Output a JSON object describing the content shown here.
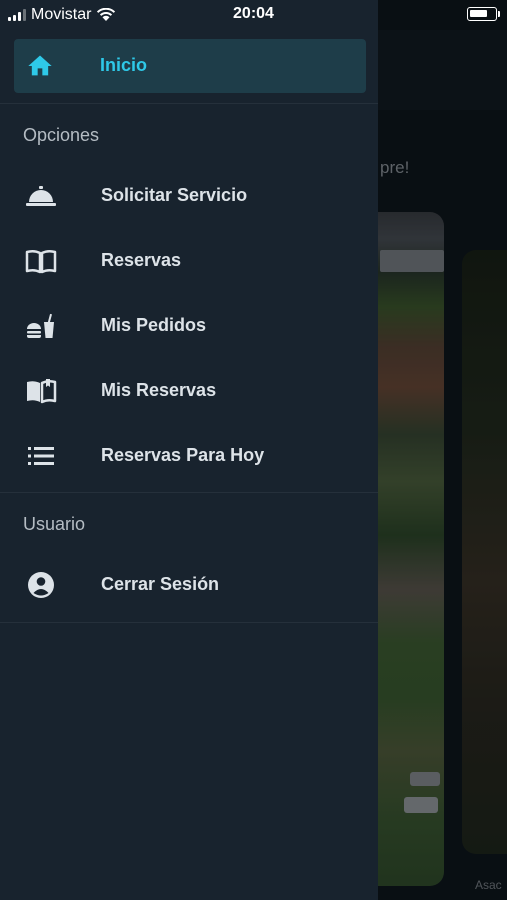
{
  "status_bar": {
    "carrier": "Movistar",
    "time": "20:04",
    "battery_level": 0.75
  },
  "background": {
    "subtext": "pre!",
    "caption": "Asac"
  },
  "drawer": {
    "home": {
      "label": "Inicio",
      "icon": "home-icon",
      "active_color": "#2ec9e8"
    },
    "sections": [
      {
        "title": "Opciones",
        "items": [
          {
            "label": "Solicitar Servicio",
            "icon": "service-bell-icon"
          },
          {
            "label": "Reservas",
            "icon": "book-open-icon"
          },
          {
            "label": "Mis Pedidos",
            "icon": "food-drink-icon"
          },
          {
            "label": "Mis Reservas",
            "icon": "book-open-outline-icon"
          },
          {
            "label": "Reservas Para Hoy",
            "icon": "list-icon"
          }
        ]
      },
      {
        "title": "Usuario",
        "items": [
          {
            "label": "Cerrar Sesión",
            "icon": "account-circle-icon"
          }
        ]
      }
    ]
  },
  "colors": {
    "drawer_bg": "#18232e",
    "active_item_bg": "#1e3d49",
    "accent": "#2ec9e8",
    "text": "#dde3e8",
    "section_title": "#b4bcc3"
  }
}
